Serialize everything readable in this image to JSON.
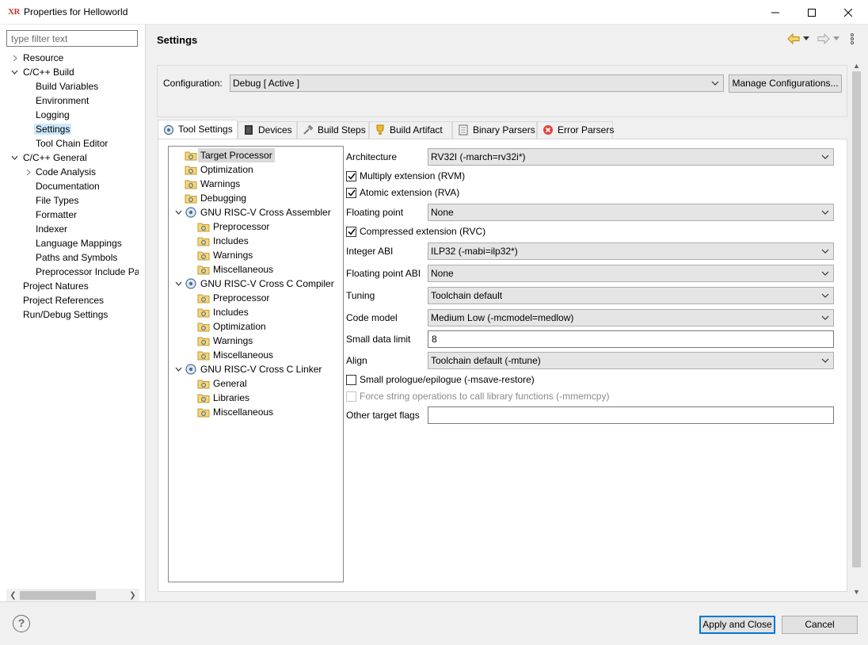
{
  "window": {
    "title": "Properties for Helloworld",
    "app_icon": "XR"
  },
  "filter": {
    "placeholder": "type filter text"
  },
  "nav": {
    "resource": "Resource",
    "cc_build": "C/C++ Build",
    "build_variables": "Build Variables",
    "environment": "Environment",
    "logging": "Logging",
    "settings": "Settings",
    "tool_chain_editor": "Tool Chain Editor",
    "cc_general": "C/C++ General",
    "code_analysis": "Code Analysis",
    "documentation": "Documentation",
    "file_types": "File Types",
    "formatter": "Formatter",
    "indexer": "Indexer",
    "language_mappings": "Language Mappings",
    "paths_and_symbols": "Paths and Symbols",
    "preprocessor_include": "Preprocessor Include Pat",
    "project_natures": "Project Natures",
    "project_references": "Project References",
    "run_debug_settings": "Run/Debug Settings"
  },
  "header": {
    "title": "Settings"
  },
  "config": {
    "label": "Configuration:",
    "value": "Debug  [ Active ]",
    "manage_button": "Manage Configurations..."
  },
  "tabs": {
    "tool_settings": "Tool Settings",
    "devices": "Devices",
    "build_steps": "Build Steps",
    "build_artifact": "Build Artifact",
    "binary_parsers": "Binary Parsers",
    "error_parsers": "Error Parsers"
  },
  "tool_tree": {
    "target_processor": "Target Processor",
    "optimization": "Optimization",
    "warnings": "Warnings",
    "debugging": "Debugging",
    "assembler": "GNU RISC-V Cross Assembler",
    "asm_preprocessor": "Preprocessor",
    "asm_includes": "Includes",
    "asm_warnings": "Warnings",
    "asm_misc": "Miscellaneous",
    "c_compiler": "GNU RISC-V Cross C Compiler",
    "cc_preprocessor": "Preprocessor",
    "cc_includes": "Includes",
    "cc_optimization": "Optimization",
    "cc_warnings": "Warnings",
    "cc_misc": "Miscellaneous",
    "linker": "GNU RISC-V Cross C Linker",
    "ld_general": "General",
    "ld_libraries": "Libraries",
    "ld_misc": "Miscellaneous"
  },
  "form": {
    "architecture": {
      "label": "Architecture",
      "value": "RV32I (-march=rv32i*)"
    },
    "multiply": {
      "label": "Multiply extension (RVM)",
      "checked": true
    },
    "atomic": {
      "label": "Atomic extension (RVA)",
      "checked": true
    },
    "floating_point": {
      "label": "Floating point",
      "value": "None"
    },
    "compressed": {
      "label": "Compressed extension (RVC)",
      "checked": true
    },
    "integer_abi": {
      "label": "Integer ABI",
      "value": "ILP32 (-mabi=ilp32*)"
    },
    "fp_abi": {
      "label": "Floating point ABI",
      "value": "None"
    },
    "tuning": {
      "label": "Tuning",
      "value": "Toolchain default"
    },
    "code_model": {
      "label": "Code model",
      "value": "Medium Low (-mcmodel=medlow)"
    },
    "small_data_limit": {
      "label": "Small data limit",
      "value": "8"
    },
    "align": {
      "label": "Align",
      "value": "Toolchain default (-mtune)"
    },
    "small_prologue": {
      "label": "Small prologue/epilogue (-msave-restore)",
      "checked": false
    },
    "force_string": {
      "label": "Force string operations to call library functions (-mmemcpy)",
      "checked": false,
      "disabled": true
    },
    "other_flags": {
      "label": "Other target flags",
      "value": ""
    }
  },
  "footer": {
    "help": "?",
    "apply_close": "Apply and Close",
    "cancel": "Cancel"
  },
  "colors": {
    "selection": "#cce8ff",
    "accent": "#0078d7"
  }
}
